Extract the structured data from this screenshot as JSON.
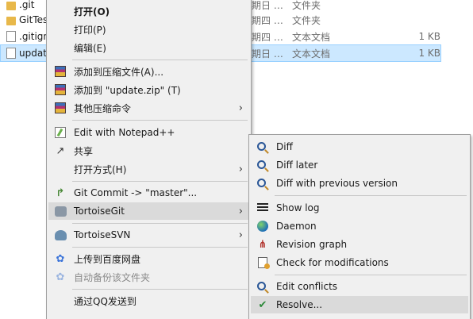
{
  "files": [
    {
      "name": ".git",
      "date": "期日 …",
      "type": "文件夹",
      "size": "",
      "icon": "folder-icon",
      "selected": false
    },
    {
      "name": "GitTest",
      "date": "期四 …",
      "type": "文件夹",
      "size": "",
      "icon": "folder-icon",
      "selected": false
    },
    {
      "name": ".gitignor",
      "date": "期四 …",
      "type": "文本文档",
      "size": "1 KB",
      "icon": "text-file-icon",
      "selected": false
    },
    {
      "name": "update.t",
      "date": "期日 …",
      "type": "文本文档",
      "size": "1 KB",
      "icon": "text-file-icon",
      "selected": true
    }
  ],
  "context_menu": {
    "items": [
      {
        "label": "打开(O)",
        "icon": "",
        "bold": true
      },
      {
        "label": "打印(P)",
        "icon": ""
      },
      {
        "label": "编辑(E)",
        "icon": ""
      },
      {
        "label": "添加到压缩文件(A)...",
        "icon": "winrar-icon"
      },
      {
        "label": "添加到 \"update.zip\" (T)",
        "icon": "winrar-icon"
      },
      {
        "label": "其他压缩命令",
        "icon": "winrar-icon",
        "submenu": true
      },
      {
        "label": "Edit with Notepad++",
        "icon": "notepad-plus-plus-icon"
      },
      {
        "label": "共享",
        "icon": "share-icon"
      },
      {
        "label": "打开方式(H)",
        "icon": "",
        "submenu": true
      },
      {
        "label": "Git Commit -> \"master\"...",
        "icon": "git-commit-icon"
      },
      {
        "label": "TortoiseGit",
        "icon": "tortoisegit-icon",
        "submenu": true,
        "highlighted": true
      },
      {
        "label": "TortoiseSVN",
        "icon": "tortoisesvn-icon",
        "submenu": true
      },
      {
        "label": "上传到百度网盘",
        "icon": "baidu-cloud-icon"
      },
      {
        "label": "自动备份该文件夹",
        "icon": "baidu-cloud-icon",
        "disabled": true
      },
      {
        "label": "通过QQ发送到",
        "icon": ""
      }
    ],
    "arrow_glyph": "›"
  },
  "tortoisegit_submenu": {
    "items": [
      {
        "label": "Diff",
        "icon": "magnifier-icon"
      },
      {
        "label": "Diff later",
        "icon": "magnifier-icon"
      },
      {
        "label": "Diff with previous version",
        "icon": "magnifier-icon"
      },
      {
        "label": "Show log",
        "icon": "log-icon"
      },
      {
        "label": "Daemon",
        "icon": "daemon-icon"
      },
      {
        "label": "Revision graph",
        "icon": "revision-graph-icon"
      },
      {
        "label": "Check for modifications",
        "icon": "check-modifications-icon"
      },
      {
        "label": "Edit conflicts",
        "icon": "edit-conflicts-icon"
      },
      {
        "label": "Resolve...",
        "icon": "resolve-icon",
        "highlighted": true
      }
    ]
  },
  "colors": {
    "menu_bg": "#f0f0f0",
    "highlight": "#dadada",
    "selection": "#cce8ff",
    "selection_border": "#99d1ff"
  }
}
